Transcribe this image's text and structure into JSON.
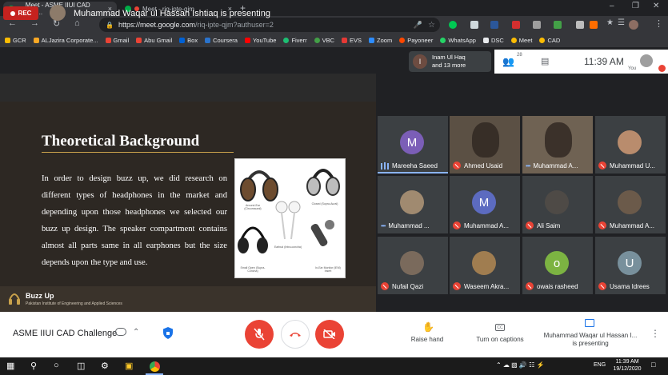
{
  "browser": {
    "tabs": [
      {
        "title": "Meet - ASME IIUI CAD Cha...",
        "close": "×"
      },
      {
        "title": "Meet - riq-ipte-qjm",
        "close": "×"
      }
    ],
    "new_tab": "+",
    "window_controls": [
      "–",
      "❐",
      "✕"
    ],
    "url_host": "https://meet.google.com",
    "url_path": "/riq-ipte-qjm?authuser=2",
    "bookmarks": [
      "GCR",
      "ALJazira Corporate...",
      "Gmail",
      "Abu Gmail",
      "Box",
      "Coursera",
      "YouTube",
      "Fiverr",
      "VBC",
      "EVS",
      "Zoom",
      "Payoneer",
      "WhatsApp",
      "DSC",
      "Meet",
      "CAD"
    ]
  },
  "meet": {
    "rec_label": "REC",
    "presenting_title": "Muhammad Waqar ul Hassan Ishtiaq is presenting",
    "people_chip": {
      "initial": "I",
      "line1": "Inam Ul Haq",
      "line2": "and 13 more"
    },
    "participant_count": "28",
    "clock": "11:39 AM",
    "you_label": "You"
  },
  "slide": {
    "title": "Theoretical Background",
    "body": "In order to design buzz up, we did research on different types of headphones in the market and depending upon those headphones we selected our buzz up design. The speaker compartment contains almost all parts same in all earphones but the size depends upon the type and use.",
    "brand_name": "Buzz Up",
    "brand_sub": "Pakistan Institute of Engineering and Applied Sciences",
    "image_captions": [
      "Around-Ear (Circumaural)",
      "Closed (Supra-Aural)",
      "Earbud (Intra-concha)",
      "Small Open (Supra-Concha)",
      "In-Ear Monitor (IEM) Insert"
    ]
  },
  "participants": [
    {
      "name": "Mareeha Saeed",
      "initial": "M",
      "color": "#7b5eb7",
      "status": "speaking"
    },
    {
      "name": "Ahmed Usaid",
      "initial": "",
      "color": "#5b5044",
      "status": "muted",
      "video": true
    },
    {
      "name": "Muhammad A...",
      "initial": "",
      "color": "#6f6253",
      "status": "dots",
      "video": true
    },
    {
      "name": "Muhammad U...",
      "initial": "",
      "color": "#b98c6d",
      "status": "muted"
    },
    {
      "name": "Muhammad ...",
      "initial": "",
      "color": "#a08a70",
      "status": "dots"
    },
    {
      "name": "Muhammad A...",
      "initial": "M",
      "color": "#5c6bc0",
      "status": "muted"
    },
    {
      "name": "Ali Saim",
      "initial": "",
      "color": "#4e4a46",
      "status": "muted"
    },
    {
      "name": "Muhammad A...",
      "initial": "",
      "color": "#6b5a4a",
      "status": "muted"
    },
    {
      "name": "Nufail Qazi",
      "initial": "",
      "color": "#7a6a5c",
      "status": "muted"
    },
    {
      "name": "Waseem Akra...",
      "initial": "",
      "color": "#a07d50",
      "status": "muted"
    },
    {
      "name": "owais rasheed",
      "initial": "o",
      "color": "#7cb342",
      "status": "muted"
    },
    {
      "name": "Usama Idrees",
      "initial": "U",
      "color": "#78909c",
      "status": "muted"
    }
  ],
  "controls": {
    "meeting_title": "ASME IIUI CAD Challenge",
    "raise_hand": "Raise hand",
    "captions": "Turn on captions",
    "presenting": "Muhammad Waqar ul Hassan I... is presenting"
  },
  "taskbar": {
    "lang": "ENG",
    "time": "11:39 AM",
    "date": "19/12/2020"
  },
  "colors": {
    "rec": "#c5221f",
    "muted": "#ea4335",
    "speaking": "#8ab4f8",
    "slide_bg": "#2d2823"
  }
}
